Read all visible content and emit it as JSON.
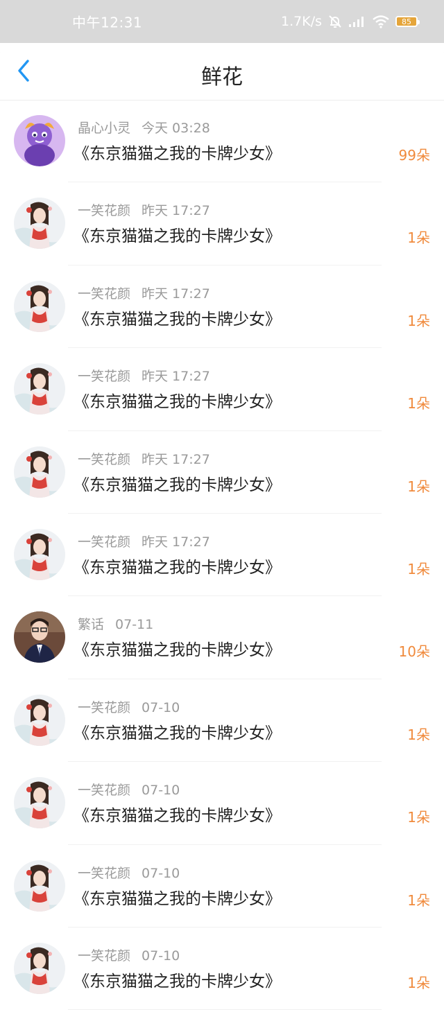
{
  "status_bar": {
    "time": "中午12:31",
    "network_speed": "1.7K/s",
    "battery_level": "85",
    "icons": [
      "mute-bell-icon",
      "signal-icon",
      "wifi-icon",
      "battery-icon"
    ]
  },
  "header": {
    "title": "鲜花",
    "back_icon": "chevron-left-icon",
    "accent_color": "#2196f3"
  },
  "colors": {
    "count": "#f08a3c",
    "meta": "#9a9a9a",
    "title": "#222222"
  },
  "list": [
    {
      "user": "晶心小灵",
      "time": "今天 03:28",
      "book": "《东京猫猫之我的卡牌少女》",
      "count": "99朵",
      "avatar": "purple-cartoon-avatar"
    },
    {
      "user": "一笑花颜",
      "time": "昨天 17:27",
      "book": "《东京猫猫之我的卡牌少女》",
      "count": "1朵",
      "avatar": "anime-girl-avatar"
    },
    {
      "user": "一笑花颜",
      "time": "昨天 17:27",
      "book": "《东京猫猫之我的卡牌少女》",
      "count": "1朵",
      "avatar": "anime-girl-avatar"
    },
    {
      "user": "一笑花颜",
      "time": "昨天 17:27",
      "book": "《东京猫猫之我的卡牌少女》",
      "count": "1朵",
      "avatar": "anime-girl-avatar"
    },
    {
      "user": "一笑花颜",
      "time": "昨天 17:27",
      "book": "《东京猫猫之我的卡牌少女》",
      "count": "1朵",
      "avatar": "anime-girl-avatar"
    },
    {
      "user": "一笑花颜",
      "time": "昨天 17:27",
      "book": "《东京猫猫之我的卡牌少女》",
      "count": "1朵",
      "avatar": "anime-girl-avatar"
    },
    {
      "user": "繁话",
      "time": "07-11",
      "book": "《东京猫猫之我的卡牌少女》",
      "count": "10朵",
      "avatar": "boy-photo-avatar"
    },
    {
      "user": "一笑花颜",
      "time": "07-10",
      "book": "《东京猫猫之我的卡牌少女》",
      "count": "1朵",
      "avatar": "anime-girl-avatar"
    },
    {
      "user": "一笑花颜",
      "time": "07-10",
      "book": "《东京猫猫之我的卡牌少女》",
      "count": "1朵",
      "avatar": "anime-girl-avatar"
    },
    {
      "user": "一笑花颜",
      "time": "07-10",
      "book": "《东京猫猫之我的卡牌少女》",
      "count": "1朵",
      "avatar": "anime-girl-avatar"
    },
    {
      "user": "一笑花颜",
      "time": "07-10",
      "book": "《东京猫猫之我的卡牌少女》",
      "count": "1朵",
      "avatar": "anime-girl-avatar"
    }
  ]
}
